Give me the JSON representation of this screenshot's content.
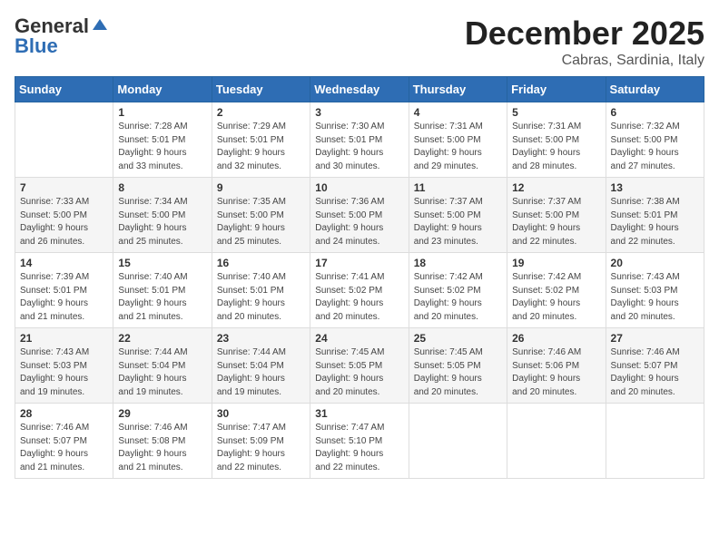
{
  "header": {
    "logo_general": "General",
    "logo_blue": "Blue",
    "month": "December 2025",
    "location": "Cabras, Sardinia, Italy"
  },
  "weekdays": [
    "Sunday",
    "Monday",
    "Tuesday",
    "Wednesday",
    "Thursday",
    "Friday",
    "Saturday"
  ],
  "weeks": [
    [
      {
        "day": "",
        "info": ""
      },
      {
        "day": "1",
        "info": "Sunrise: 7:28 AM\nSunset: 5:01 PM\nDaylight: 9 hours\nand 33 minutes."
      },
      {
        "day": "2",
        "info": "Sunrise: 7:29 AM\nSunset: 5:01 PM\nDaylight: 9 hours\nand 32 minutes."
      },
      {
        "day": "3",
        "info": "Sunrise: 7:30 AM\nSunset: 5:01 PM\nDaylight: 9 hours\nand 30 minutes."
      },
      {
        "day": "4",
        "info": "Sunrise: 7:31 AM\nSunset: 5:00 PM\nDaylight: 9 hours\nand 29 minutes."
      },
      {
        "day": "5",
        "info": "Sunrise: 7:31 AM\nSunset: 5:00 PM\nDaylight: 9 hours\nand 28 minutes."
      },
      {
        "day": "6",
        "info": "Sunrise: 7:32 AM\nSunset: 5:00 PM\nDaylight: 9 hours\nand 27 minutes."
      }
    ],
    [
      {
        "day": "7",
        "info": "Sunrise: 7:33 AM\nSunset: 5:00 PM\nDaylight: 9 hours\nand 26 minutes."
      },
      {
        "day": "8",
        "info": "Sunrise: 7:34 AM\nSunset: 5:00 PM\nDaylight: 9 hours\nand 25 minutes."
      },
      {
        "day": "9",
        "info": "Sunrise: 7:35 AM\nSunset: 5:00 PM\nDaylight: 9 hours\nand 25 minutes."
      },
      {
        "day": "10",
        "info": "Sunrise: 7:36 AM\nSunset: 5:00 PM\nDaylight: 9 hours\nand 24 minutes."
      },
      {
        "day": "11",
        "info": "Sunrise: 7:37 AM\nSunset: 5:00 PM\nDaylight: 9 hours\nand 23 minutes."
      },
      {
        "day": "12",
        "info": "Sunrise: 7:37 AM\nSunset: 5:00 PM\nDaylight: 9 hours\nand 22 minutes."
      },
      {
        "day": "13",
        "info": "Sunrise: 7:38 AM\nSunset: 5:01 PM\nDaylight: 9 hours\nand 22 minutes."
      }
    ],
    [
      {
        "day": "14",
        "info": "Sunrise: 7:39 AM\nSunset: 5:01 PM\nDaylight: 9 hours\nand 21 minutes."
      },
      {
        "day": "15",
        "info": "Sunrise: 7:40 AM\nSunset: 5:01 PM\nDaylight: 9 hours\nand 21 minutes."
      },
      {
        "day": "16",
        "info": "Sunrise: 7:40 AM\nSunset: 5:01 PM\nDaylight: 9 hours\nand 20 minutes."
      },
      {
        "day": "17",
        "info": "Sunrise: 7:41 AM\nSunset: 5:02 PM\nDaylight: 9 hours\nand 20 minutes."
      },
      {
        "day": "18",
        "info": "Sunrise: 7:42 AM\nSunset: 5:02 PM\nDaylight: 9 hours\nand 20 minutes."
      },
      {
        "day": "19",
        "info": "Sunrise: 7:42 AM\nSunset: 5:02 PM\nDaylight: 9 hours\nand 20 minutes."
      },
      {
        "day": "20",
        "info": "Sunrise: 7:43 AM\nSunset: 5:03 PM\nDaylight: 9 hours\nand 20 minutes."
      }
    ],
    [
      {
        "day": "21",
        "info": "Sunrise: 7:43 AM\nSunset: 5:03 PM\nDaylight: 9 hours\nand 19 minutes."
      },
      {
        "day": "22",
        "info": "Sunrise: 7:44 AM\nSunset: 5:04 PM\nDaylight: 9 hours\nand 19 minutes."
      },
      {
        "day": "23",
        "info": "Sunrise: 7:44 AM\nSunset: 5:04 PM\nDaylight: 9 hours\nand 19 minutes."
      },
      {
        "day": "24",
        "info": "Sunrise: 7:45 AM\nSunset: 5:05 PM\nDaylight: 9 hours\nand 20 minutes."
      },
      {
        "day": "25",
        "info": "Sunrise: 7:45 AM\nSunset: 5:05 PM\nDaylight: 9 hours\nand 20 minutes."
      },
      {
        "day": "26",
        "info": "Sunrise: 7:46 AM\nSunset: 5:06 PM\nDaylight: 9 hours\nand 20 minutes."
      },
      {
        "day": "27",
        "info": "Sunrise: 7:46 AM\nSunset: 5:07 PM\nDaylight: 9 hours\nand 20 minutes."
      }
    ],
    [
      {
        "day": "28",
        "info": "Sunrise: 7:46 AM\nSunset: 5:07 PM\nDaylight: 9 hours\nand 21 minutes."
      },
      {
        "day": "29",
        "info": "Sunrise: 7:46 AM\nSunset: 5:08 PM\nDaylight: 9 hours\nand 21 minutes."
      },
      {
        "day": "30",
        "info": "Sunrise: 7:47 AM\nSunset: 5:09 PM\nDaylight: 9 hours\nand 22 minutes."
      },
      {
        "day": "31",
        "info": "Sunrise: 7:47 AM\nSunset: 5:10 PM\nDaylight: 9 hours\nand 22 minutes."
      },
      {
        "day": "",
        "info": ""
      },
      {
        "day": "",
        "info": ""
      },
      {
        "day": "",
        "info": ""
      }
    ]
  ]
}
